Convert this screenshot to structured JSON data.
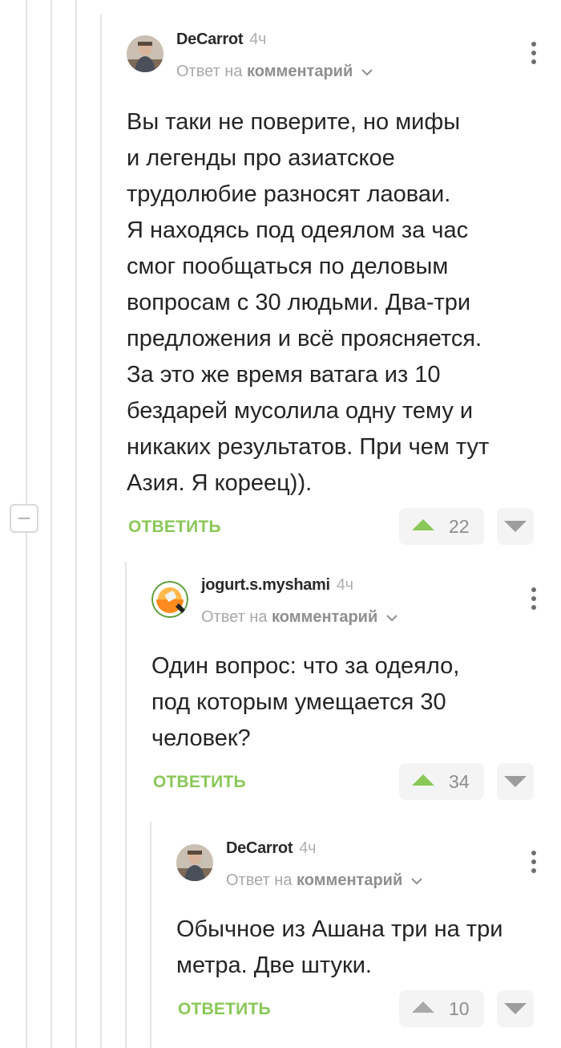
{
  "comments": [
    {
      "author": "DeCarrot",
      "time": "4ч",
      "reply_prefix": "Ответ на",
      "reply_link": "комментарий",
      "text": "Вы таки не поверите, но мифы\nи легенды про азиатское\nтрудолюбие разносят лаоваи.\nЯ находясь под одеялом за час\nсмог пообщаться по деловым\nвопросам с 30 людьми. Два-три\nпредложения и всё проясняется.\nЗа это же время ватага из 10\nбездарей мусолила одну тему и\nникаких результатов. При чем тут\nАзия. Я кореец)).",
      "reply_label": "ОТВЕТИТЬ",
      "votes": "22",
      "upvoted": true
    },
    {
      "author": "jogurt.s.myshami",
      "time": "4ч",
      "reply_prefix": "Ответ на",
      "reply_link": "комментарий",
      "text": "Один вопрос: что за одеяло,\nпод которым умещается 30\nчеловек?",
      "reply_label": "ОТВЕТИТЬ",
      "votes": "34",
      "upvoted": true
    },
    {
      "author": "DeCarrot",
      "time": "4ч",
      "reply_prefix": "Ответ на",
      "reply_link": "комментарий",
      "text": "Обычное из Ашана три на три\nметра. Две штуки.",
      "reply_label": "ОТВЕТИТЬ",
      "votes": "10",
      "upvoted": false
    }
  ],
  "colors": {
    "accent": "#8ac858",
    "thread_line": "#e4e4e4",
    "vote_bg": "#f4f4f4"
  },
  "icons": [
    "avatar-decarrot",
    "avatar-jogurt",
    "more-vertical-icon",
    "chevron-down-icon",
    "upvote-icon",
    "downvote-icon",
    "collapse-icon"
  ]
}
